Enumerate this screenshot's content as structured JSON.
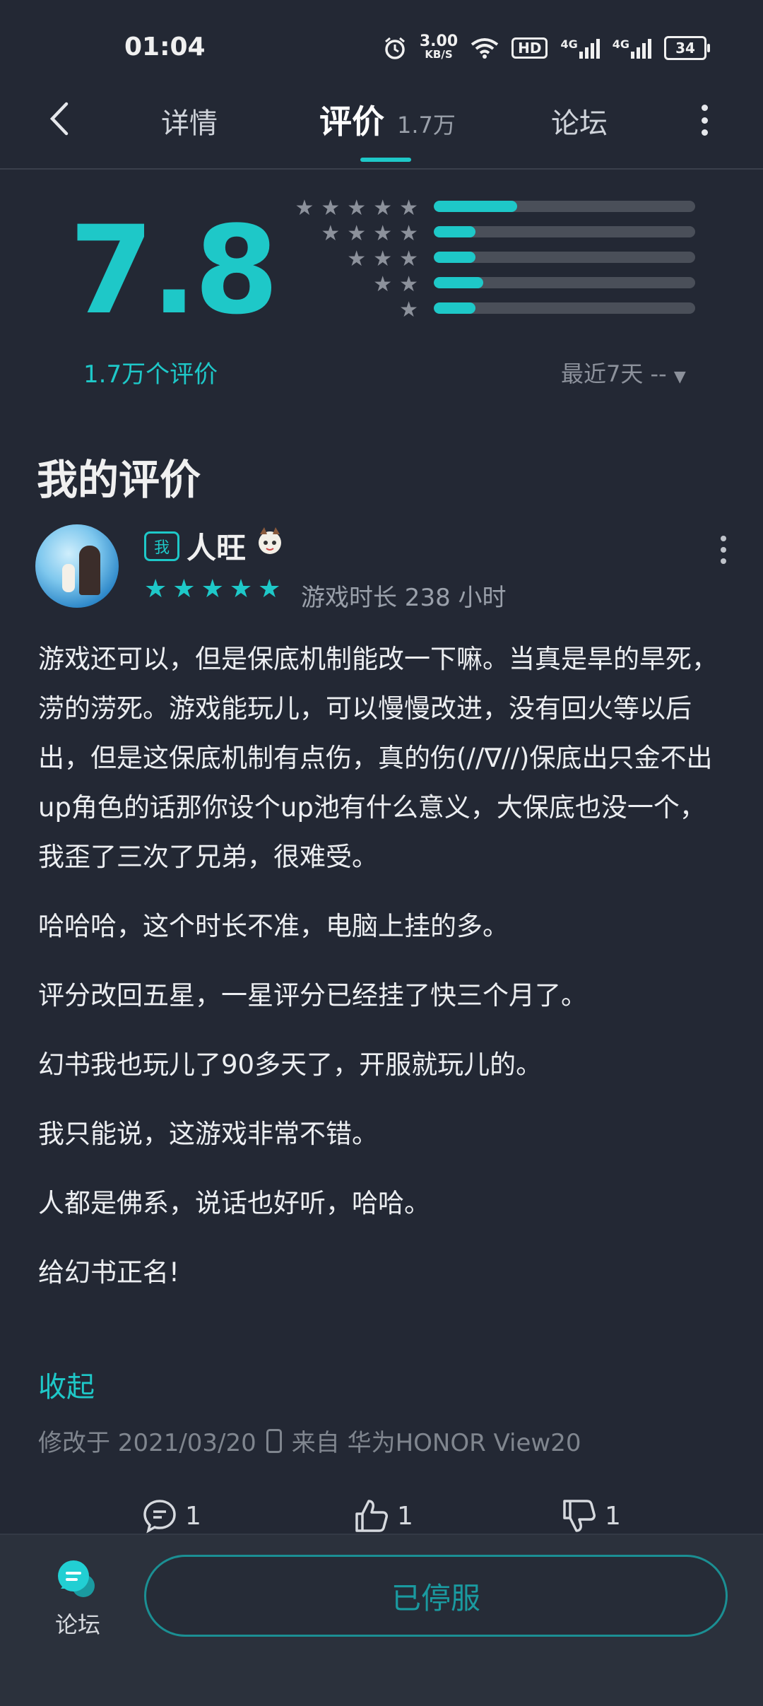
{
  "status_bar": {
    "time": "01:04",
    "speed_value": "3.00",
    "speed_unit": "KB/S",
    "hd_label": "HD",
    "network_1": "4G",
    "network_2": "4G",
    "battery": "34"
  },
  "nav": {
    "tabs": [
      {
        "label": "详情"
      },
      {
        "label": "评价",
        "badge": "1.7万",
        "active": true
      },
      {
        "label": "论坛"
      }
    ]
  },
  "rating": {
    "score": "7.8",
    "count_label": "1.7万个评价",
    "distribution": [
      {
        "stars": 5,
        "fraction": 0.32
      },
      {
        "stars": 4,
        "fraction": 0.16
      },
      {
        "stars": 3,
        "fraction": 0.16
      },
      {
        "stars": 2,
        "fraction": 0.19
      },
      {
        "stars": 1,
        "fraction": 0.16
      }
    ],
    "filter_label": "最近7天 --"
  },
  "my_review": {
    "section_title": "我的评价",
    "me_badge": "我",
    "username": "人旺",
    "user_rating": 5,
    "playtime": "游戏时长 238 小时",
    "paragraphs": [
      "游戏还可以，但是保底机制能改一下嘛。当真是旱的旱死，涝的涝死。游戏能玩儿，可以慢慢改进，没有回火等以后出，但是这保底机制有点伤，真的伤(//∇//)保底出只金不出up角色的话那你设个up池有什么意义，大保底也没一个，我歪了三次了兄弟，很难受。",
      "哈哈哈，这个时长不准，电脑上挂的多。",
      "评分改回五星，一星评分已经挂了快三个月了。",
      "幻书我也玩儿了90多天了，开服就玩儿的。",
      "我只能说，这游戏非常不错。",
      "人都是佛系，说话也好听，哈哈。",
      "给幻书正名!"
    ],
    "collapse_label": "收起",
    "modified": "修改于 2021/03/20",
    "device": "来自 华为HONOR View20",
    "actions": {
      "comments": "1",
      "likes": "1",
      "dislikes": "1"
    }
  },
  "bottom": {
    "forum_label": "论坛",
    "service_button": "已停服"
  },
  "colors": {
    "accent": "#1ec8c8",
    "background": "#232834",
    "bottom_bar": "#2b313c"
  }
}
